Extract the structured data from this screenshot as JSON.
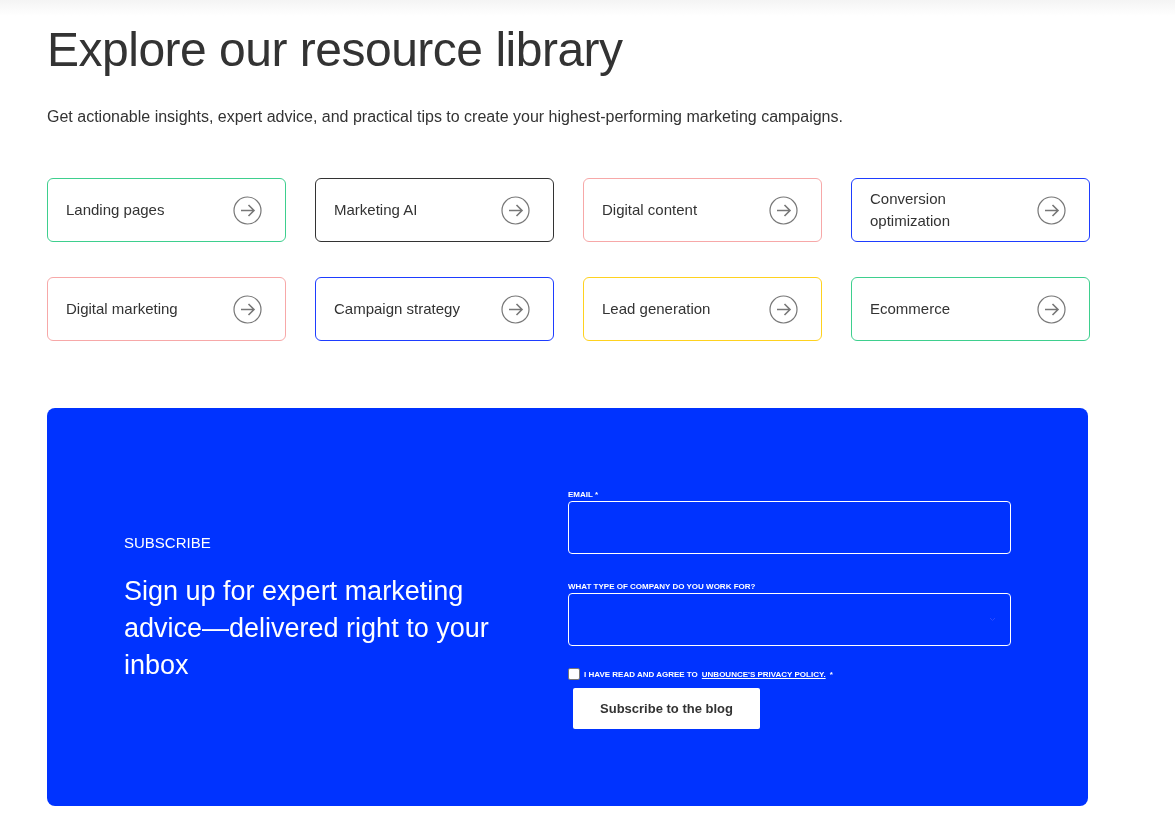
{
  "heading": "Explore our resource library",
  "intro": "Get actionable insights, expert advice, and practical tips to create your highest-performing marketing campaigns.",
  "topics": [
    {
      "label": "Landing pages",
      "color": "#3ecf8e"
    },
    {
      "label": "Marketing AI",
      "color": "#333333"
    },
    {
      "label": "Digital content",
      "color": "#f7a8a8"
    },
    {
      "label": "Conversion optimization",
      "color": "#1e3dff"
    },
    {
      "label": "Digital marketing",
      "color": "#f7a8a8"
    },
    {
      "label": "Campaign strategy",
      "color": "#1e3dff"
    },
    {
      "label": "Lead generation",
      "color": "#ffd21f"
    },
    {
      "label": "Ecommerce",
      "color": "#3ecf8e"
    }
  ],
  "subscribe": {
    "eyebrow": "SUBSCRIBE",
    "title": "Sign up for expert marketing advice—delivered right to your inbox",
    "email_label": "EMAIL *",
    "company_label": "WHAT TYPE OF COMPANY DO YOU WORK FOR?",
    "consent": {
      "checked": false,
      "text": "I HAVE READ AND AGREE TO",
      "link": "UNBOUNCE'S PRIVACY POLICY.",
      "required_mark": "*"
    },
    "button": "Subscribe to the blog"
  }
}
